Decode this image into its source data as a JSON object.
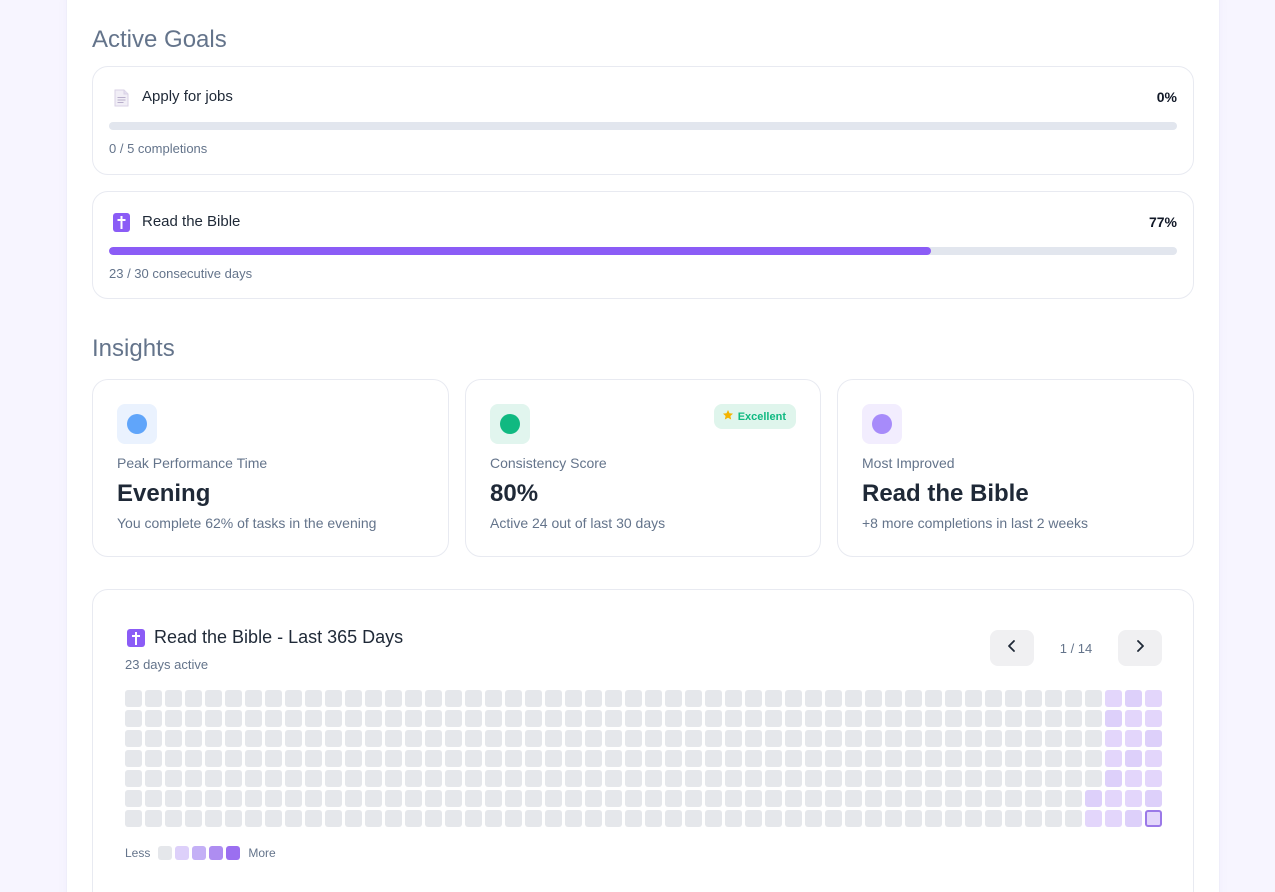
{
  "sections": {
    "active_goals_title": "Active Goals",
    "insights_title": "Insights"
  },
  "goals": [
    {
      "name": "Apply for jobs",
      "percent_label": "0%",
      "progress": 0,
      "subtitle": "0 / 5 completions",
      "icon": "document-icon"
    },
    {
      "name": "Read the Bible",
      "percent_label": "77%",
      "progress": 77,
      "subtitle": "23 / 30 consecutive days",
      "icon": "latin-cross-icon"
    }
  ],
  "insights": [
    {
      "label": "Peak Performance Time",
      "value": "Evening",
      "description": "You complete 62% of tasks in the evening",
      "icon_color": "#60a5fa",
      "icon_bg": "#eaf2fe"
    },
    {
      "label": "Consistency Score",
      "value": "80%",
      "description": "Active 24 out of last 30 days",
      "icon_color": "#10b981",
      "icon_bg": "#e1f5ee",
      "badge": "Excellent",
      "badge_icon": "star-icon"
    },
    {
      "label": "Most Improved",
      "value": "Read the Bible",
      "description": "+8 more completions in last 2 weeks",
      "icon_color": "#a78bfa",
      "icon_bg": "#f2edfe"
    }
  ],
  "heatmap": {
    "title": "Read the Bible - Last 365 Days",
    "subtitle": "23 days active",
    "page_indicator": "1 / 14",
    "prev_icon": "chevron-left-icon",
    "next_icon": "chevron-right-icon",
    "weeks": 52,
    "active_days": 23,
    "legend_less": "Less",
    "legend_more": "More",
    "legend_colors": [
      "#e5e7eb",
      "#ddd0fa",
      "#c4b0f6",
      "#ae8df1",
      "#9b6ff0"
    ]
  },
  "colors": {
    "accent": "#8b5cf6",
    "track": "#e2e6ee",
    "success": "#10b981"
  }
}
